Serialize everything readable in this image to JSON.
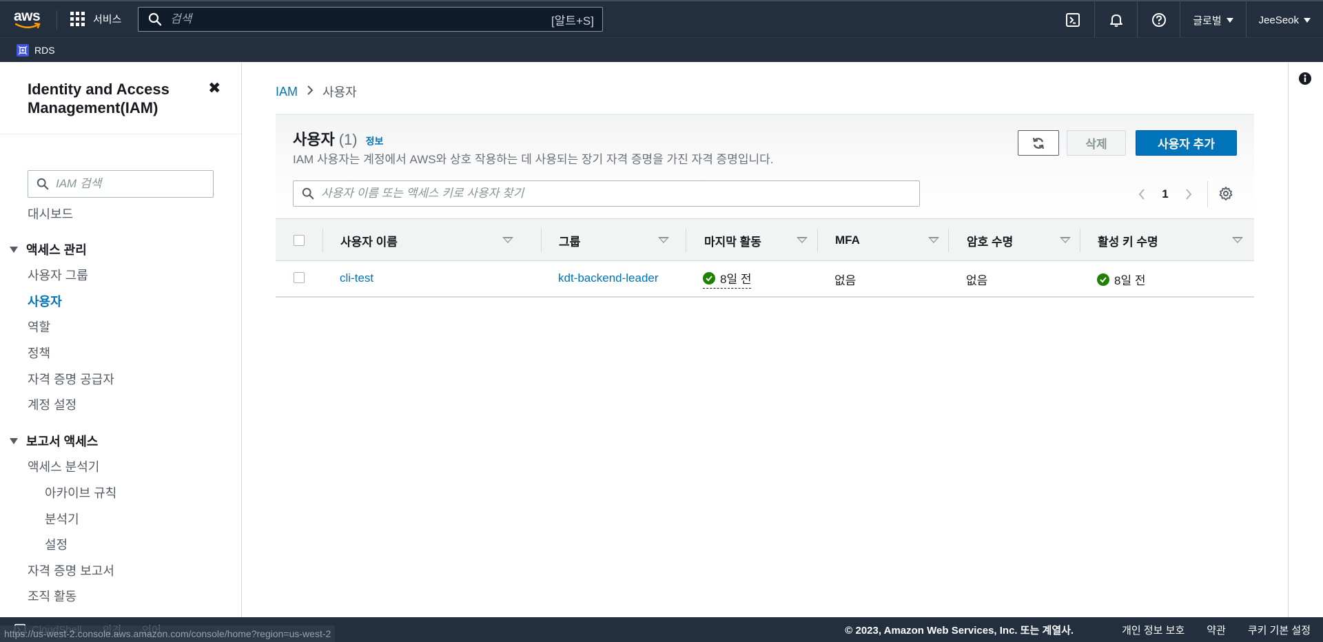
{
  "topnav": {
    "logo_text": "aws",
    "services_label": "서비스",
    "search_placeholder": "검색",
    "search_shortcut": "[알트+S]",
    "region_label": "글로벌",
    "user_label": "JeeSeok",
    "icons": [
      "cloudshell-icon",
      "notification-bell-icon",
      "help-icon"
    ]
  },
  "favorites": {
    "rds_label": "RDS"
  },
  "sidebar": {
    "title": "Identity and Access Management(IAM)",
    "close_glyph": "✖",
    "search_placeholder": "IAM 검색",
    "dashboard": "대시보드",
    "access_mgmt": {
      "label": "액세스 관리",
      "items": [
        "사용자 그룹",
        "사용자",
        "역할",
        "정책",
        "자격 증명 공급자",
        "계정 설정"
      ]
    },
    "reports": {
      "label": "보고서 액세스",
      "analyzer": "액세스 분석기",
      "analyzer_sub": [
        "아카이브 규칙",
        "분석기",
        "설정"
      ],
      "credential_report": "자격 증명 보고서",
      "org_activity": "조직 활동"
    },
    "active_item": "사용자"
  },
  "breadcrumb": {
    "root": "IAM",
    "current": "사용자"
  },
  "panel": {
    "title": "사용자",
    "count": "(1)",
    "info_link": "정보",
    "description": "IAM 사용자는 계정에서 AWS와 상호 작용하는 데 사용되는 장기 자격 증명을 가진 자격 증명입니다.",
    "delete_label": "삭제",
    "add_label": "사용자 추가",
    "filter_placeholder": "사용자 이름 또는 액세스 키로 사용자 찾기",
    "page_number": "1"
  },
  "table": {
    "columns": [
      "사용자 이름",
      "그룹",
      "마지막 활동",
      "MFA",
      "암호 수명",
      "활성 키 수명"
    ],
    "rows": [
      {
        "user_name": "cli-test",
        "group": "kdt-backend-leader",
        "last_activity": "8일 전",
        "mfa": "없음",
        "password_age": "없음",
        "active_key_age": "8일 전"
      }
    ]
  },
  "footer": {
    "cloudshell": "CloudShell",
    "feedback": "의견",
    "language": "언어",
    "copyright": "© 2023, Amazon Web Services, Inc. 또는 계열사.",
    "privacy": "개인 정보 보호",
    "terms": "약관",
    "cookies": "쿠키 기본 설정"
  },
  "status_url": "https://us-west-2.console.aws.amazon.com/console/home?region=us-west-2",
  "colors": {
    "nav_bg": "#232f3e",
    "link": "#0073bb",
    "primary_button": "#0073bb",
    "success": "#1d8102"
  }
}
